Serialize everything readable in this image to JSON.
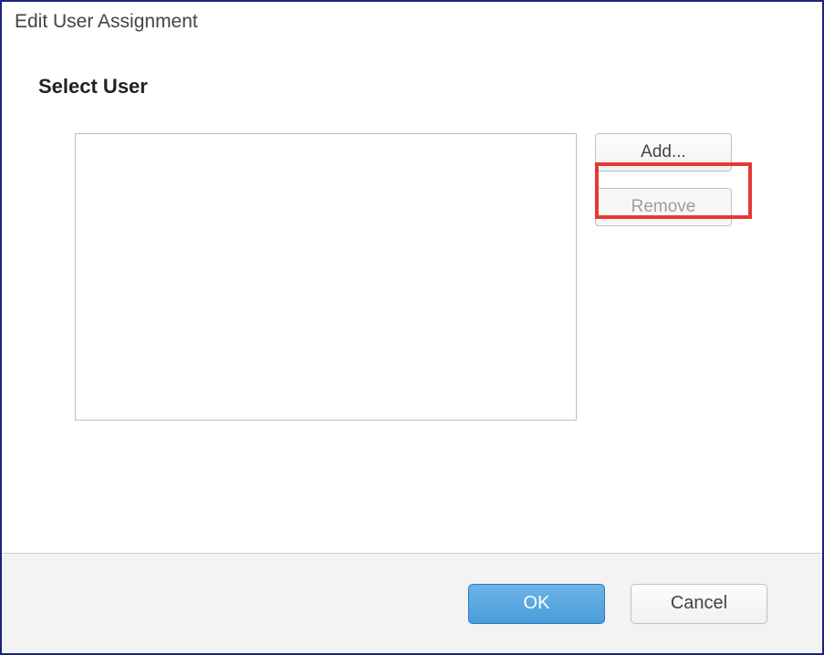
{
  "window": {
    "title": "Edit User Assignment"
  },
  "section": {
    "heading": "Select User"
  },
  "buttons": {
    "add": "Add...",
    "remove": "Remove",
    "ok": "OK",
    "cancel": "Cancel"
  },
  "state": {
    "remove_enabled": false,
    "add_highlighted": true
  }
}
